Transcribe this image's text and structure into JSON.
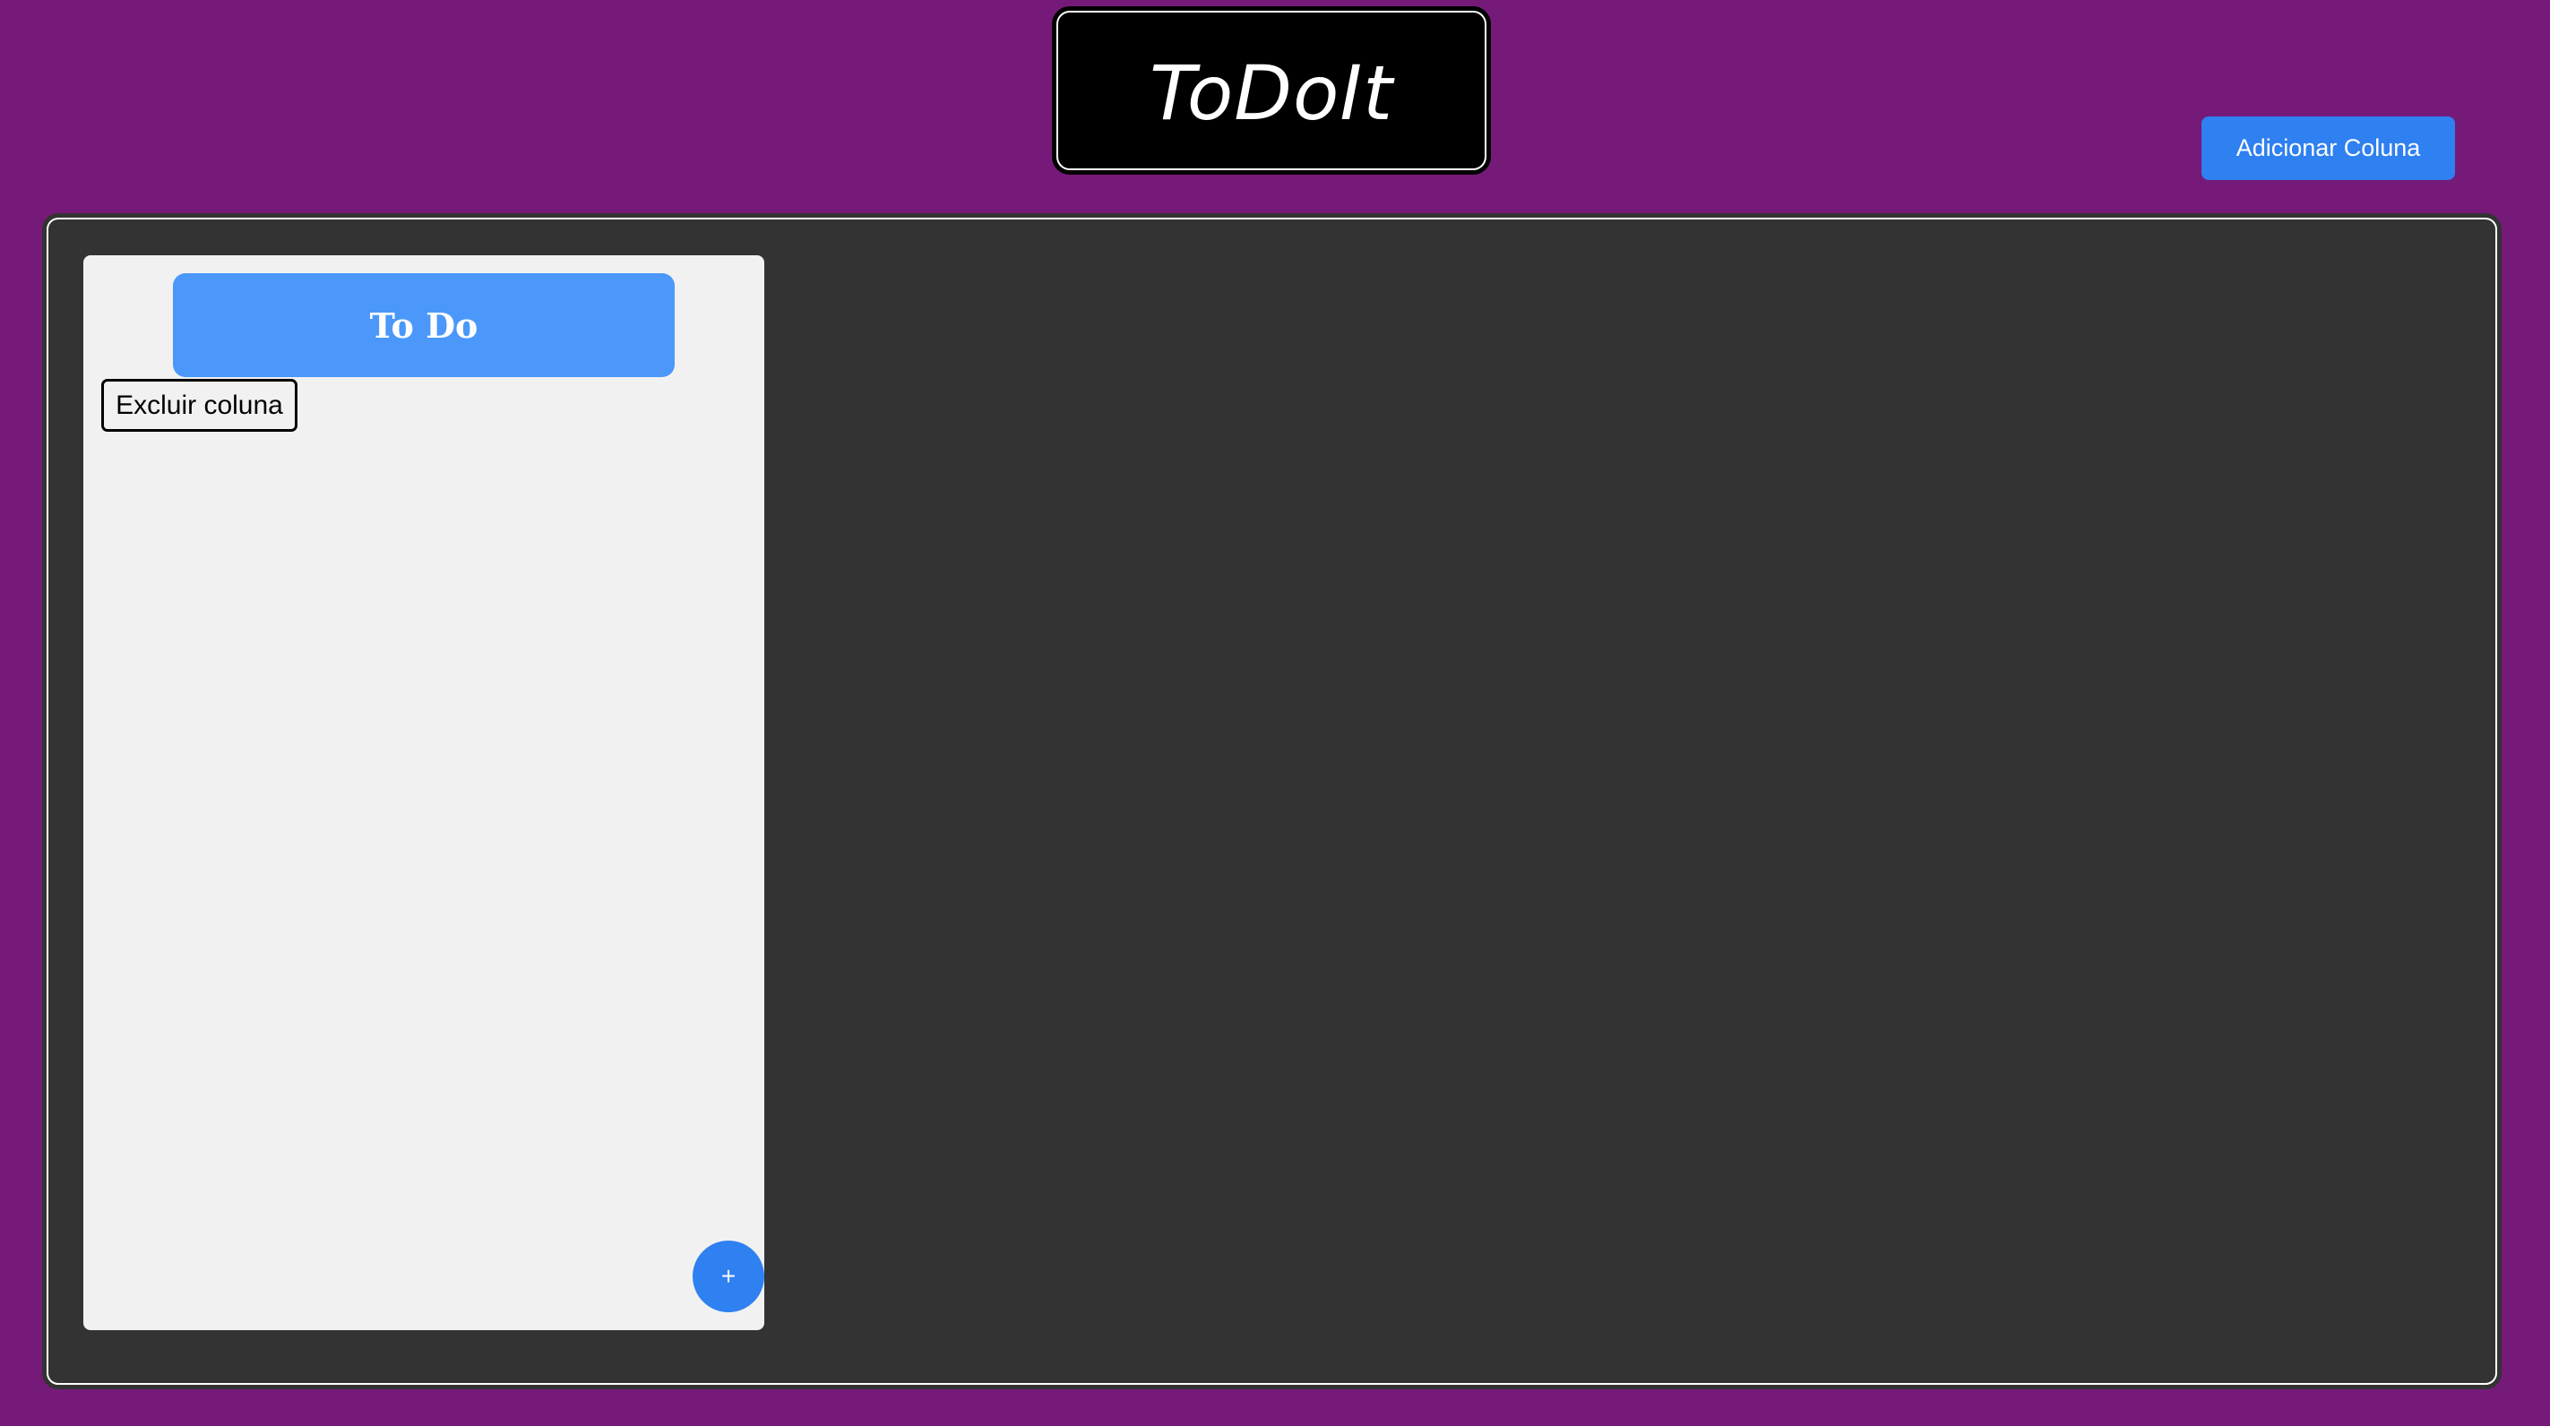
{
  "header": {
    "logo_text": "ToDoIt",
    "add_column_label": "Adicionar Coluna"
  },
  "board": {
    "columns": [
      {
        "title": "To Do",
        "delete_label": "Excluir coluna",
        "add_card_label": "+",
        "cards": []
      }
    ]
  },
  "colors": {
    "page_background": "#761a7a",
    "board_background": "#333333",
    "column_background": "#f1f1f1",
    "column_header": "#4b98fa",
    "primary_button": "#2f80f0",
    "logo_background": "#000000"
  }
}
